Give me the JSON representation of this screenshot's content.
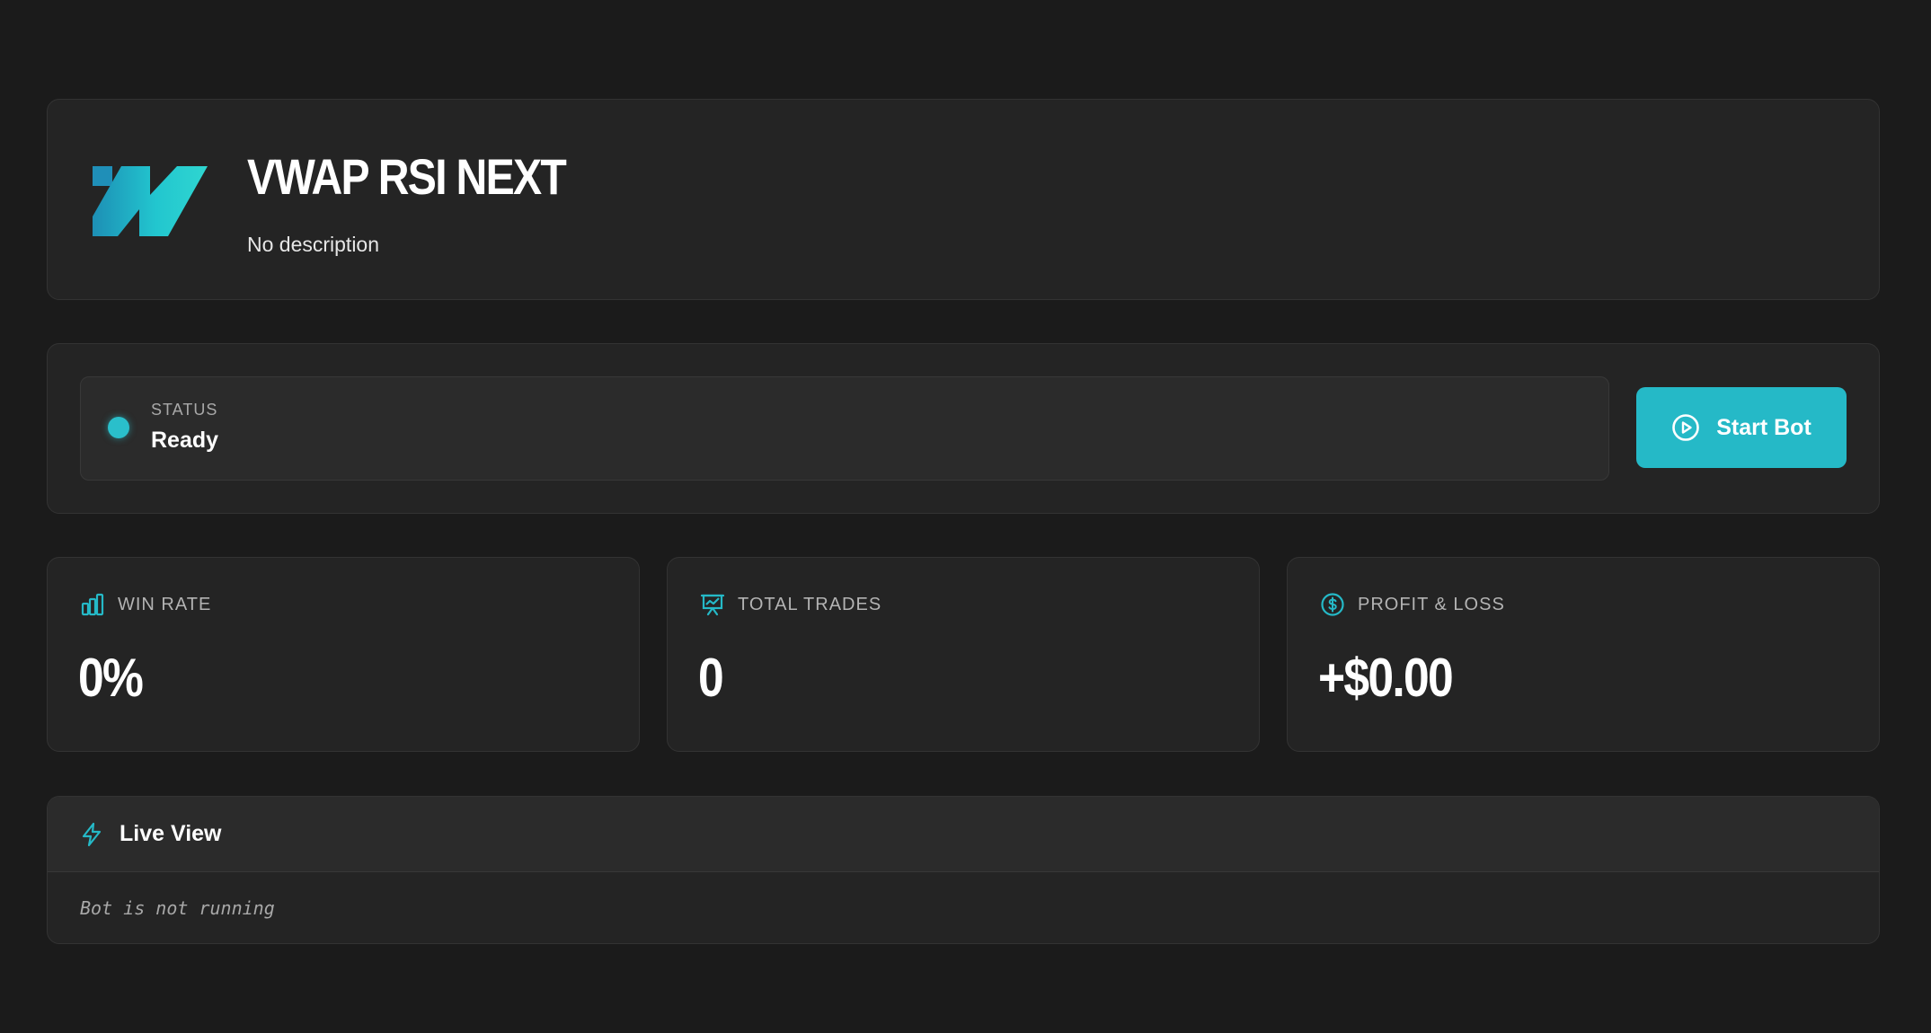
{
  "bot": {
    "title": "VWAP RSI NEXT",
    "description": "No description"
  },
  "status": {
    "label": "STATUS",
    "value": "Ready",
    "indicator_color": "#2abfcb"
  },
  "actions": {
    "start_label": "Start Bot",
    "icon": "play-circle-icon",
    "color": "#25b9c7"
  },
  "stats": [
    {
      "label": "WIN RATE",
      "value": "0%",
      "icon": "bar-chart-icon"
    },
    {
      "label": "TOTAL TRADES",
      "value": "0",
      "icon": "presentation-chart-icon"
    },
    {
      "label": "PROFIT & LOSS",
      "value": "+$0.00",
      "icon": "dollar-circle-icon"
    }
  ],
  "live_view": {
    "title": "Live View",
    "icon": "lightning-icon",
    "message": "Bot is not running"
  },
  "colors": {
    "background": "#1b1b1b",
    "card": "#242424",
    "accent": "#25b9c7"
  }
}
